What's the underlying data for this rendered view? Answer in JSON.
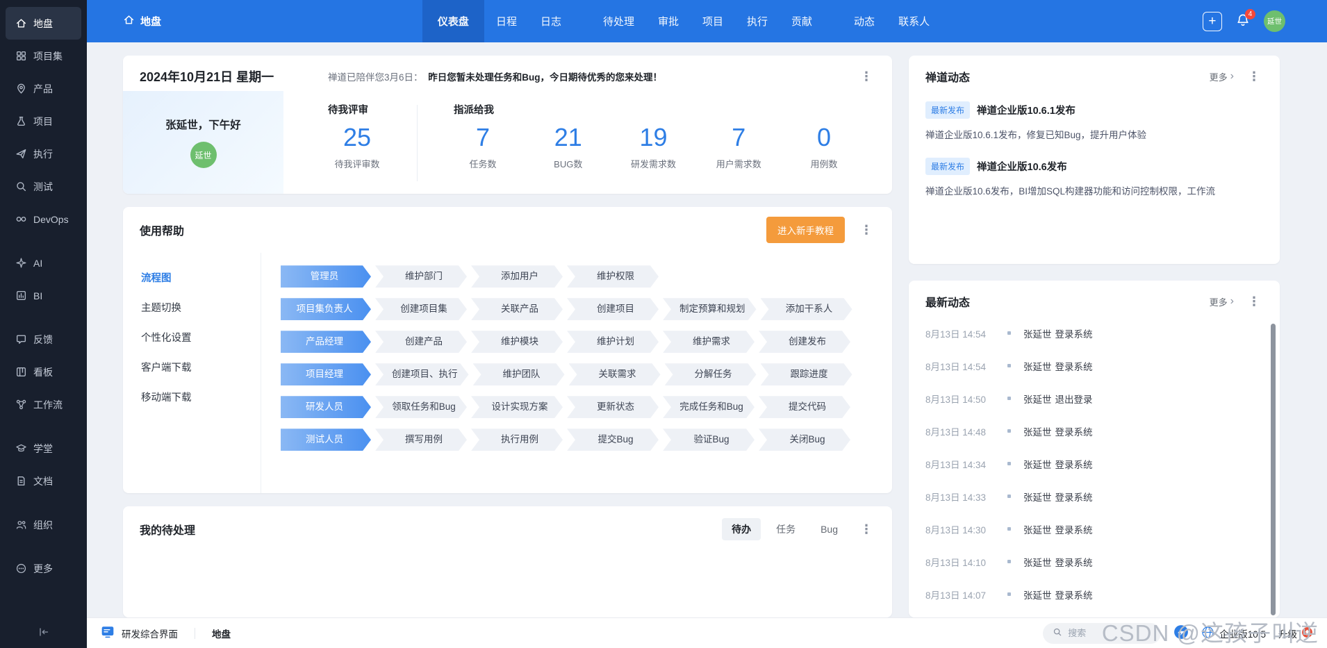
{
  "icons": {
    "kebab": "⋮",
    "chevron_right": "›",
    "plus": "+"
  },
  "navbar": {
    "brand": "地盘",
    "tabs": [
      "仪表盘",
      "日程",
      "日志",
      "待处理",
      "审批",
      "项目",
      "执行",
      "贡献",
      "动态",
      "联系人"
    ],
    "bell_badge": "4",
    "avatar": "延世"
  },
  "sidebar": {
    "items": [
      {
        "label": "地盘"
      },
      {
        "label": "项目集"
      },
      {
        "label": "产品"
      },
      {
        "label": "项目"
      },
      {
        "label": "执行"
      },
      {
        "label": "测试"
      },
      {
        "label": "DevOps"
      },
      {
        "label": "AI"
      },
      {
        "label": "BI"
      },
      {
        "label": "反馈"
      },
      {
        "label": "看板"
      },
      {
        "label": "工作流"
      },
      {
        "label": "学堂"
      },
      {
        "label": "文档"
      },
      {
        "label": "组织"
      },
      {
        "label": "更多"
      }
    ]
  },
  "overview": {
    "date": "2024年10月21日 星期一",
    "message_prefix": "禅道已陪伴您3月6日：",
    "message_strong": "昨日您暂未处理任务和Bug，今日期待优秀的您来处理！",
    "greeting": "张延世，下午好",
    "avatar": "延世",
    "review_group": {
      "title": "待我评审",
      "stats": [
        {
          "value": "25",
          "label": "待我评审数"
        }
      ]
    },
    "assigned_group": {
      "title": "指派给我",
      "stats": [
        {
          "value": "7",
          "label": "任务数"
        },
        {
          "value": "21",
          "label": "BUG数"
        },
        {
          "value": "19",
          "label": "研发需求数"
        },
        {
          "value": "7",
          "label": "用户需求数"
        },
        {
          "value": "0",
          "label": "用例数"
        }
      ]
    }
  },
  "help": {
    "title": "使用帮助",
    "cta": "进入新手教程",
    "menu": [
      {
        "label": "流程图"
      },
      {
        "label": "主题切换"
      },
      {
        "label": "个性化设置"
      },
      {
        "label": "客户端下载"
      },
      {
        "label": "移动端下载"
      }
    ],
    "rows": [
      [
        "管理员",
        "维护部门",
        "添加用户",
        "维护权限"
      ],
      [
        "项目集负责人",
        "创建项目集",
        "关联产品",
        "创建项目",
        "制定预算和规划",
        "添加干系人"
      ],
      [
        "产品经理",
        "创建产品",
        "维护模块",
        "维护计划",
        "维护需求",
        "创建发布"
      ],
      [
        "项目经理",
        "创建项目、执行",
        "维护团队",
        "关联需求",
        "分解任务",
        "跟踪进度"
      ],
      [
        "研发人员",
        "领取任务和Bug",
        "设计实现方案",
        "更新状态",
        "完成任务和Bug",
        "提交代码"
      ],
      [
        "测试人员",
        "撰写用例",
        "执行用例",
        "提交Bug",
        "验证Bug",
        "关闭Bug"
      ]
    ]
  },
  "todo": {
    "title": "我的待处理",
    "tabs": [
      {
        "label": "待办"
      },
      {
        "label": "任务"
      },
      {
        "label": "Bug"
      }
    ]
  },
  "news": {
    "title": "禅道动态",
    "more": "更多",
    "items": [
      {
        "badge": "最新发布",
        "title": "禅道企业版10.6.1发布",
        "desc": "禅道企业版10.6.1发布，修复已知Bug，提升用户体验"
      },
      {
        "badge": "最新发布",
        "title": "禅道企业版10.6发布",
        "desc": "禅道企业版10.6发布，BI增加SQL构建器功能和访问控制权限，工作流"
      }
    ]
  },
  "activity": {
    "title": "最新动态",
    "more": "更多",
    "items": [
      {
        "time": "8月13日 14:54",
        "user": "张延世",
        "action": "登录系统"
      },
      {
        "time": "8月13日 14:54",
        "user": "张延世",
        "action": "登录系统"
      },
      {
        "time": "8月13日 14:50",
        "user": "张延世",
        "action": "退出登录"
      },
      {
        "time": "8月13日 14:48",
        "user": "张延世",
        "action": "登录系统"
      },
      {
        "time": "8月13日 14:34",
        "user": "张延世",
        "action": "登录系统"
      },
      {
        "time": "8月13日 14:33",
        "user": "张延世",
        "action": "登录系统"
      },
      {
        "time": "8月13日 14:30",
        "user": "张延世",
        "action": "登录系统"
      },
      {
        "time": "8月13日 14:10",
        "user": "张延世",
        "action": "登录系统"
      },
      {
        "time": "8月13日 14:07",
        "user": "张延世",
        "action": "登录系统"
      }
    ]
  },
  "footer": {
    "workspace": "研发综合界面",
    "current": "地盘",
    "search_placeholder": "搜索",
    "version": "企业版10.5",
    "upgrade": "升级"
  },
  "watermark": "CSDN @这孩子叫逆"
}
